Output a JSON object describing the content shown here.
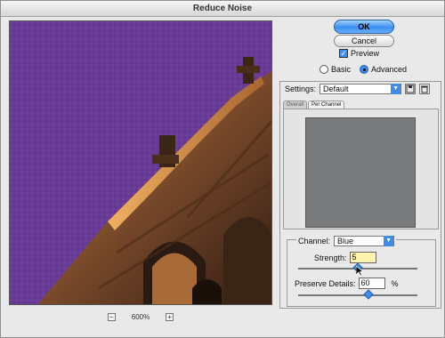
{
  "window": {
    "title": "Reduce Noise"
  },
  "preview": {
    "zoom": "600%",
    "zoom_out": "−",
    "zoom_in": "+"
  },
  "buttons": {
    "ok": "OK",
    "cancel": "Cancel"
  },
  "preview_checkbox": {
    "label": "Preview",
    "checked": true,
    "mark": "✓"
  },
  "mode": {
    "basic": "Basic",
    "advanced": "Advanced",
    "selected": "Advanced"
  },
  "settings": {
    "label": "Settings:",
    "value": "Default"
  },
  "tabs": [
    {
      "label": "Overall",
      "active": false
    },
    {
      "label": "Per Channel",
      "active": true
    }
  ],
  "channel": {
    "label": "Channel:",
    "value": "Blue"
  },
  "strength": {
    "label": "Strength:",
    "value": "5",
    "max": 10
  },
  "preserve_details": {
    "label": "Preserve Details:",
    "value": "60",
    "unit": "%"
  },
  "colors": {
    "sky": "#6a3c98",
    "accent": "#3d8cf0",
    "channel_gray": "#7a7b7d"
  },
  "icons": {
    "dropdown": "▼",
    "save_settings": "save-icon",
    "delete_settings": "trash-icon"
  }
}
